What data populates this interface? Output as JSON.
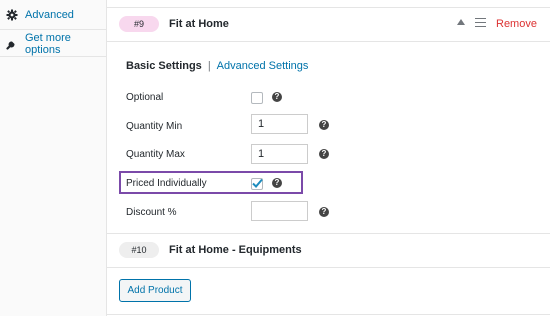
{
  "sidebar": {
    "items": [
      {
        "label": "Advanced",
        "icon": "gear-icon"
      },
      {
        "label": "Get more options",
        "icon": "wrench-icon"
      }
    ]
  },
  "product1": {
    "badge": "#9",
    "title": "Fit at Home",
    "remove_label": "Remove",
    "tabs": {
      "basic": "Basic Settings",
      "separator": "|",
      "advanced": "Advanced Settings"
    },
    "fields": {
      "optional": {
        "label": "Optional",
        "checked": false
      },
      "qty_min": {
        "label": "Quantity Min",
        "value": "1"
      },
      "qty_max": {
        "label": "Quantity Max",
        "value": "1"
      },
      "priced_individually": {
        "label": "Priced Individually",
        "checked": true
      },
      "discount": {
        "label": "Discount %",
        "value": ""
      }
    },
    "help_glyph": "?"
  },
  "product2": {
    "badge": "#10",
    "title": "Fit at Home - Equipments"
  },
  "add_product_label": "Add Product",
  "colors": {
    "link": "#0073aa",
    "remove": "#dc3232",
    "highlight": "#7b4aa9",
    "badge_active": "#f8d8ee"
  }
}
